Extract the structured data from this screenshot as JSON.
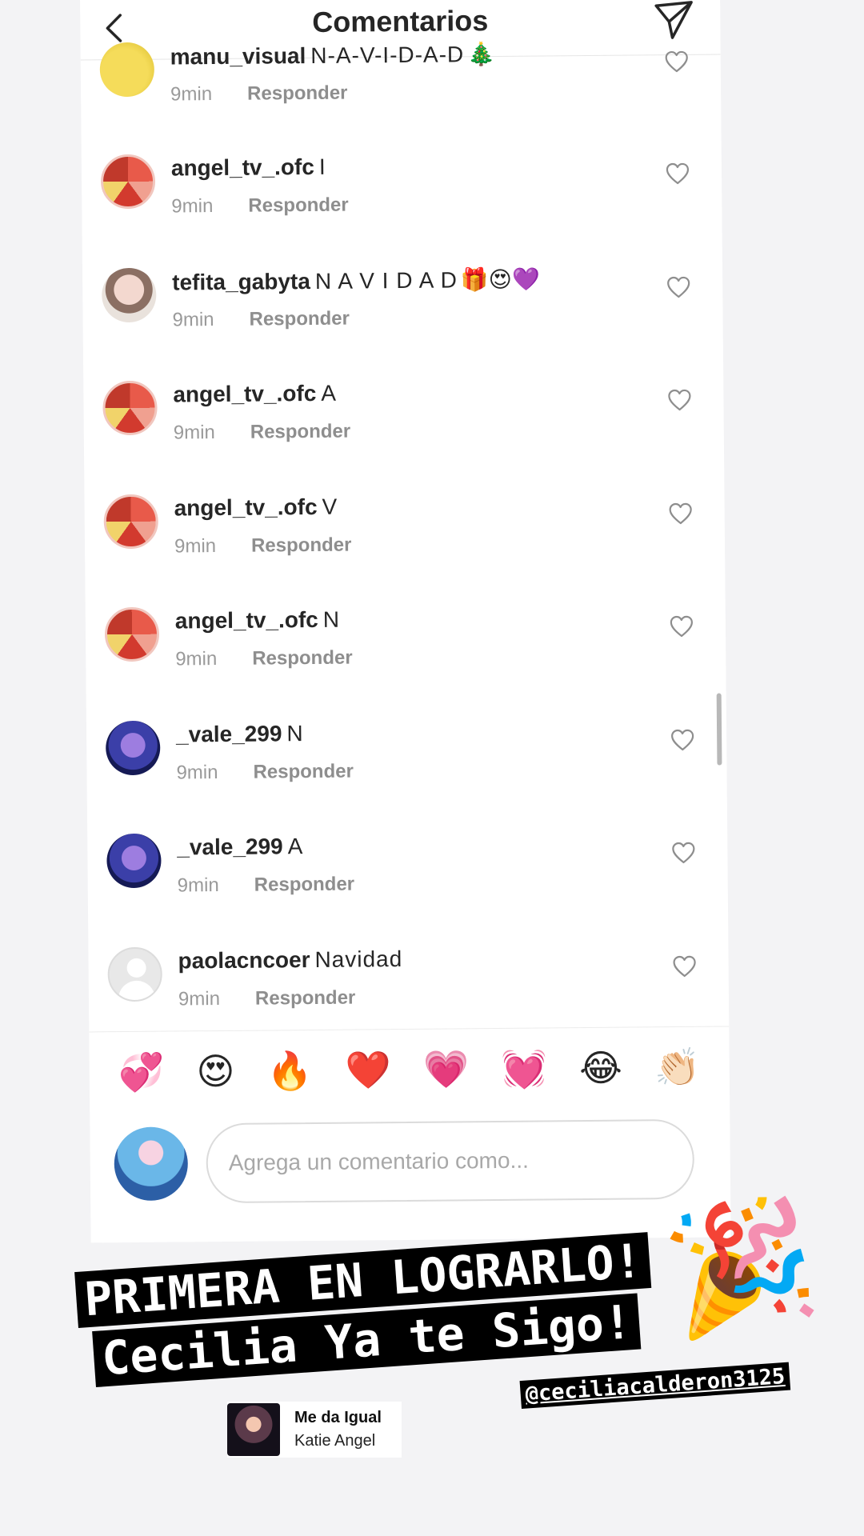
{
  "header": {
    "title": "Comentarios"
  },
  "comments": [
    {
      "user": "manu_visual",
      "text": "N-A-V-I-D-A-D",
      "emoji": "🎄",
      "time": "9min",
      "reply": "Responder",
      "avatar": "yellow"
    },
    {
      "user": "angel_tv_.ofc",
      "text": "I",
      "emoji": "",
      "time": "9min",
      "reply": "Responder",
      "avatar": "angel"
    },
    {
      "user": "tefita_gabyta",
      "text": "N A V I D A D",
      "emoji": "🎁😍💜",
      "time": "9min",
      "reply": "Responder",
      "avatar": "tefita"
    },
    {
      "user": "angel_tv_.ofc",
      "text": "A",
      "emoji": "",
      "time": "9min",
      "reply": "Responder",
      "avatar": "angel"
    },
    {
      "user": "angel_tv_.ofc",
      "text": "V",
      "emoji": "",
      "time": "9min",
      "reply": "Responder",
      "avatar": "angel"
    },
    {
      "user": "angel_tv_.ofc",
      "text": "N",
      "emoji": "",
      "time": "9min",
      "reply": "Responder",
      "avatar": "angel"
    },
    {
      "user": "_vale_299",
      "text": "N",
      "emoji": "",
      "time": "9min",
      "reply": "Responder",
      "avatar": "vale"
    },
    {
      "user": "_vale_299",
      "text": "A",
      "emoji": "",
      "time": "9min",
      "reply": "Responder",
      "avatar": "vale"
    },
    {
      "user": "paolacncoer",
      "text": "Navidad",
      "emoji": "",
      "time": "9min",
      "reply": "Responder",
      "avatar": "default"
    }
  ],
  "quick_emojis": [
    "💞",
    "😍",
    "🔥",
    "❤️",
    "💗",
    "💓",
    "😂",
    "👏🏻"
  ],
  "composer": {
    "placeholder": "Agrega un comentario como..."
  },
  "story": {
    "caption_line1": "PRIMERA EN LOGRARLO!",
    "caption_line2": "Cecilia Ya te Sigo!",
    "sticker": "🎉",
    "mention": "@ceciliacalderon3125",
    "music": {
      "song": "Me da Igual",
      "artist": "Katie Angel"
    }
  },
  "icons": {
    "back": "back-arrow-icon",
    "send": "paper-plane-icon",
    "like": "heart-outline-icon"
  }
}
